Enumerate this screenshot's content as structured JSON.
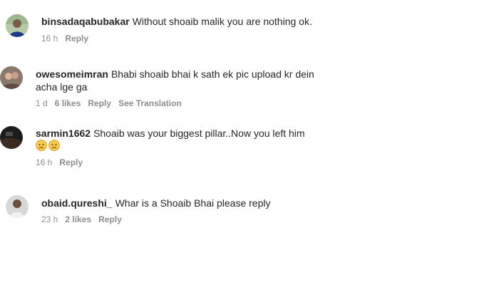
{
  "comments": [
    {
      "username": "binsadaqabubakar",
      "text": "Without shoaib malik you are nothing ok.",
      "time": "16 h",
      "likes": "",
      "reply": "Reply",
      "translation": ""
    },
    {
      "username": "owesomeimran",
      "text": "Bhabi shoaib bhai k sath ek pic upload kr dein",
      "text2": "acha lge ga",
      "time": "1 d",
      "likes": "6 likes",
      "reply": "Reply",
      "translation": "See Translation"
    },
    {
      "username": "sarmin1662",
      "text": "Shoaib was your biggest pillar..Now you left him",
      "emojis": [
        "sad-face-emoji",
        "sad-face-emoji"
      ],
      "time": "16 h",
      "likes": "",
      "reply": "Reply",
      "translation": ""
    },
    {
      "username": "obaid.qureshi_",
      "text": "Whar is a Shoaib Bhai please reply",
      "time": "23 h",
      "likes": "2 likes",
      "reply": "Reply",
      "translation": ""
    }
  ]
}
